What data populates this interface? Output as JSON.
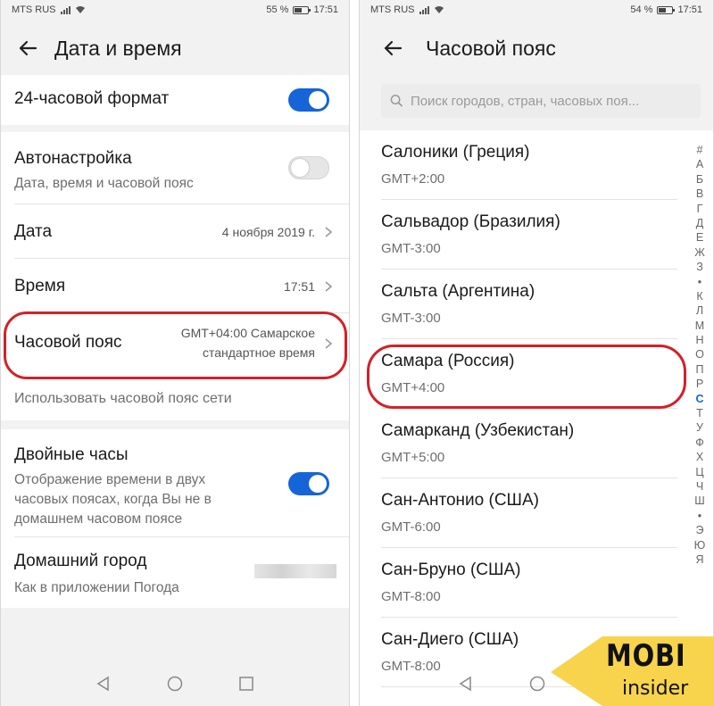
{
  "left": {
    "status": {
      "carrier": "MTS RUS",
      "battery": "55 %",
      "time": "17:51",
      "battery_level": 0.55
    },
    "title": "Дата и время",
    "format24": {
      "label": "24-часовой формат",
      "on": true
    },
    "auto": {
      "label": "Автонастройка",
      "sub": "Дата, время и часовой пояс",
      "on": false
    },
    "date": {
      "label": "Дата",
      "value": "4 ноября 2019 г."
    },
    "time": {
      "label": "Время",
      "value": "17:51"
    },
    "timezone": {
      "label": "Часовой пояс",
      "value_line1": "GMT+04:00 Самарское",
      "value_line2": "стандартное время"
    },
    "network_tz": {
      "label": "Использовать часовой пояс сети"
    },
    "dual_clock": {
      "label": "Двойные часы",
      "sub_line1": "Отображение времени в двух",
      "sub_line2": "часовых поясах, когда Вы не в",
      "sub_line3": "домашнем часовом поясе",
      "on": true
    },
    "home_city": {
      "label": "Домашний город",
      "sub": "Как в приложении Погода"
    }
  },
  "right": {
    "status": {
      "carrier": "MTS RUS",
      "battery": "54 %",
      "time": "17:51",
      "battery_level": 0.54
    },
    "title": "Часовой пояс",
    "search": {
      "placeholder": "Поиск городов, стран, часовых поя..."
    },
    "items": [
      {
        "city": "Салоники (Греция)",
        "offset": "GMT+2:00"
      },
      {
        "city": "Сальвадор (Бразилия)",
        "offset": "GMT-3:00"
      },
      {
        "city": "Сальта (Аргентина)",
        "offset": "GMT-3:00"
      },
      {
        "city": "Самара (Россия)",
        "offset": "GMT+4:00"
      },
      {
        "city": "Самарканд (Узбекистан)",
        "offset": "GMT+5:00"
      },
      {
        "city": "Сан-Антонио (США)",
        "offset": "GMT-6:00"
      },
      {
        "city": "Сан-Бруно (США)",
        "offset": "GMT-8:00"
      },
      {
        "city": "Сан-Диего (США)",
        "offset": "GMT-8:00"
      }
    ],
    "alphabet": [
      "#",
      "А",
      "Б",
      "В",
      "Г",
      "Д",
      "Е",
      "Ж",
      "З",
      "•",
      "К",
      "Л",
      "М",
      "Н",
      "О",
      "П",
      "Р",
      "С",
      "Т",
      "У",
      "Ф",
      "Х",
      "Ц",
      "Ч",
      "Ш",
      "•",
      "Э",
      "Ю",
      "Я"
    ],
    "alphabet_active": "С"
  },
  "logo": {
    "line1": "MOBI",
    "line2": "insider"
  },
  "colors": {
    "accent": "#1565d8",
    "highlight": "#d3202a"
  }
}
